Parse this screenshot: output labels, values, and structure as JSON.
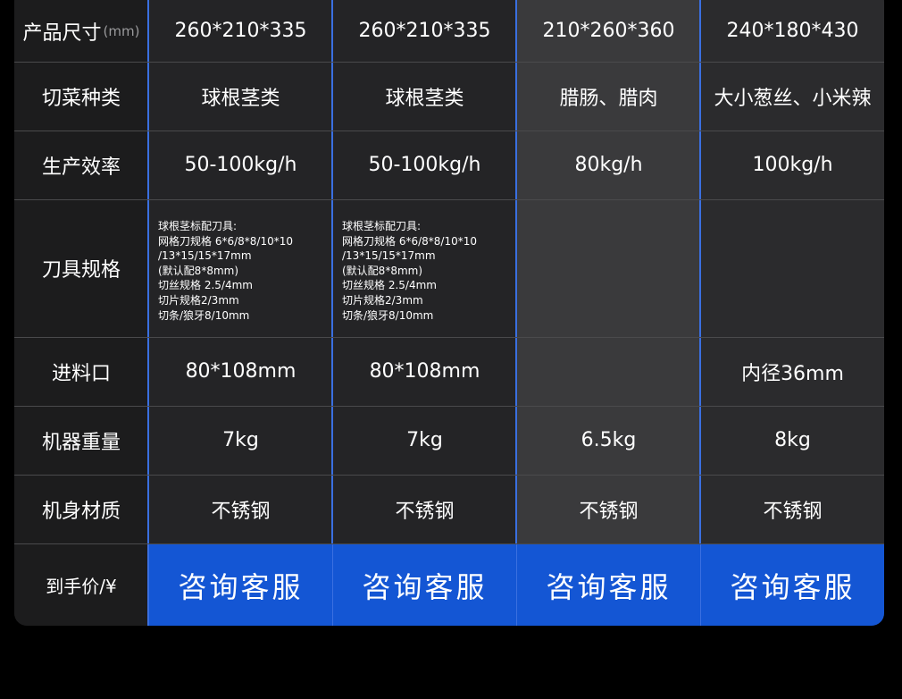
{
  "rows": [
    {
      "label": "产品尺寸",
      "unit": "(mm)",
      "values": [
        "260*210*335",
        "260*210*335",
        "210*260*360",
        "240*180*430"
      ]
    },
    {
      "label": "切菜种类",
      "values": [
        "球根茎类",
        "球根茎类",
        "腊肠、腊肉",
        "大小葱丝、小米辣"
      ]
    },
    {
      "label": "生产效率",
      "values": [
        "50-100kg/h",
        "50-100kg/h",
        "80kg/h",
        "100kg/h"
      ]
    },
    {
      "label": "刀具规格",
      "blade_specs": [
        [
          "球根茎标配刀具:",
          "网格刀规格 6*6/8*8/10*10",
          "/13*15/15*17mm",
          "(默认配8*8mm)",
          "切丝规格 2.5/4mm",
          "切片规格2/3mm",
          "切条/狼牙8/10mm"
        ],
        [
          "球根茎标配刀具:",
          "网格刀规格 6*6/8*8/10*10",
          "/13*15/15*17mm",
          "(默认配8*8mm)",
          "切丝规格 2.5/4mm",
          "切片规格2/3mm",
          "切条/狼牙8/10mm"
        ],
        [],
        []
      ]
    },
    {
      "label": "进料口",
      "values": [
        "80*108mm",
        "80*108mm",
        "",
        "内径36mm"
      ]
    },
    {
      "label": "机器重量",
      "values": [
        "7kg",
        "7kg",
        "6.5kg",
        "8kg"
      ]
    },
    {
      "label": "机身材质",
      "values": [
        "不锈钢",
        "不锈钢",
        "不锈钢",
        "不锈钢"
      ]
    }
  ],
  "price_row": {
    "label": "到手价/¥",
    "buttons": [
      "咨询客服",
      "咨询客服",
      "咨询客服",
      "咨询客服"
    ]
  },
  "colors": {
    "accent": "#3a6fe0",
    "button": "#1456d4",
    "highlight_column": "#3a3a3c"
  }
}
